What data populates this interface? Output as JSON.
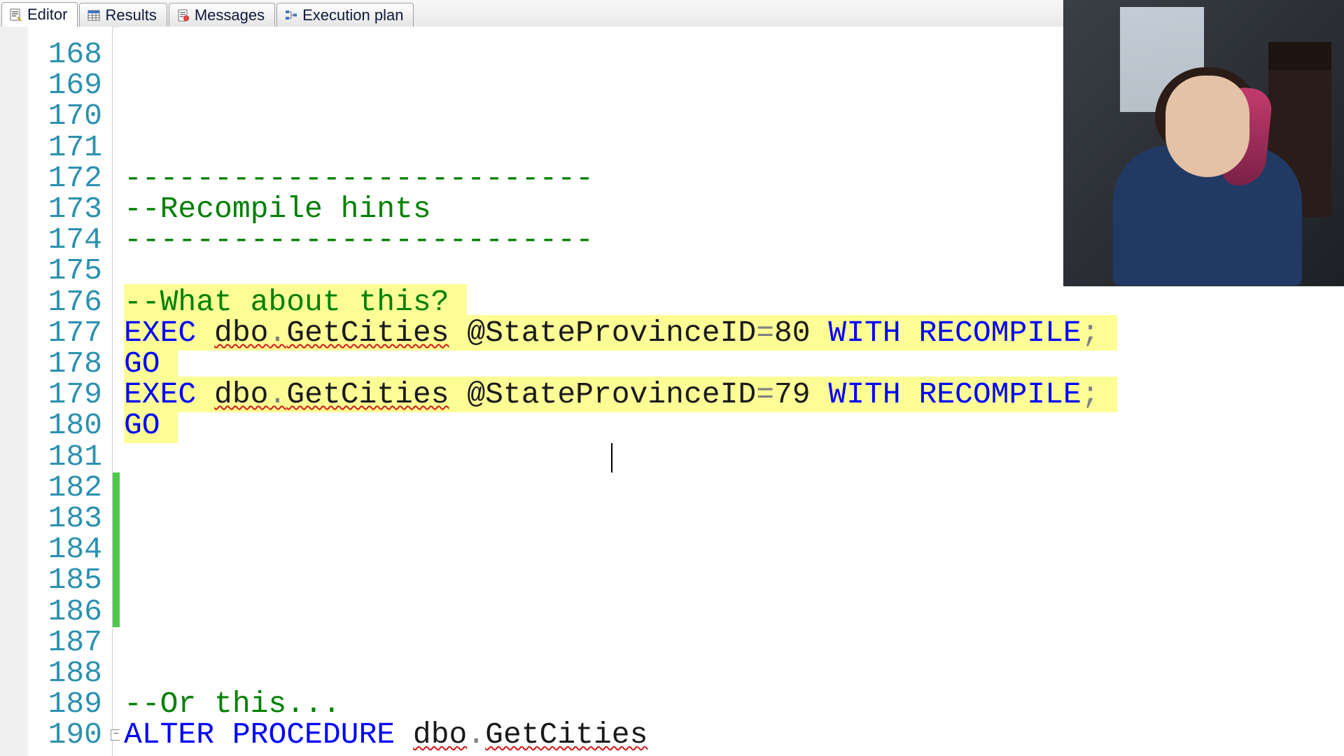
{
  "tabs": [
    {
      "label": "Editor",
      "active": true
    },
    {
      "label": "Results",
      "active": false
    },
    {
      "label": "Messages",
      "active": false
    },
    {
      "label": "Execution plan",
      "active": false
    }
  ],
  "editor": {
    "first_line": 168,
    "last_line": 190,
    "changed_lines_start": 182,
    "changed_lines_end": 186,
    "caret_line": 181,
    "fold_line": 190,
    "lines": {
      "168": [],
      "169": [],
      "170": [],
      "171": [],
      "172": [
        {
          "cls": "tok-comment",
          "text": "--------------------------"
        }
      ],
      "173": [
        {
          "cls": "tok-comment",
          "text": "--Recompile hints"
        }
      ],
      "174": [
        {
          "cls": "tok-comment",
          "text": "--------------------------"
        }
      ],
      "175": [],
      "176": [
        {
          "cls": "tok-comment",
          "text": "--What about this?",
          "sel": true
        }
      ],
      "177": [
        {
          "cls": "tok-kw",
          "text": "EXEC",
          "sel": true
        },
        {
          "cls": "tok-text",
          "text": " ",
          "sel": true
        },
        {
          "cls": "tok-text squiggle",
          "text": "dbo",
          "sel": true
        },
        {
          "cls": "tok-punct squiggle",
          "text": ".",
          "sel": true
        },
        {
          "cls": "tok-text squiggle",
          "text": "GetCities",
          "sel": true
        },
        {
          "cls": "tok-text",
          "text": " @StateProvinceID",
          "sel": true
        },
        {
          "cls": "tok-punct",
          "text": "=",
          "sel": true
        },
        {
          "cls": "tok-text",
          "text": "80 ",
          "sel": true
        },
        {
          "cls": "tok-kw",
          "text": "WITH",
          "sel": true
        },
        {
          "cls": "tok-text",
          "text": " ",
          "sel": true
        },
        {
          "cls": "tok-kw",
          "text": "RECOMPILE",
          "sel": true
        },
        {
          "cls": "tok-punct",
          "text": ";",
          "sel": true
        }
      ],
      "178": [
        {
          "cls": "tok-kw",
          "text": "GO",
          "sel": true
        }
      ],
      "179": [
        {
          "cls": "tok-kw",
          "text": "EXEC",
          "sel": true
        },
        {
          "cls": "tok-text",
          "text": " ",
          "sel": true
        },
        {
          "cls": "tok-text squiggle",
          "text": "dbo",
          "sel": true
        },
        {
          "cls": "tok-punct squiggle",
          "text": ".",
          "sel": true
        },
        {
          "cls": "tok-text squiggle",
          "text": "GetCities",
          "sel": true
        },
        {
          "cls": "tok-text",
          "text": " @StateProvinceID",
          "sel": true
        },
        {
          "cls": "tok-punct",
          "text": "=",
          "sel": true
        },
        {
          "cls": "tok-text",
          "text": "79 ",
          "sel": true
        },
        {
          "cls": "tok-kw",
          "text": "WITH",
          "sel": true
        },
        {
          "cls": "tok-text",
          "text": " ",
          "sel": true
        },
        {
          "cls": "tok-kw",
          "text": "RECOMPILE",
          "sel": true
        },
        {
          "cls": "tok-punct",
          "text": ";",
          "sel": true
        }
      ],
      "180": [
        {
          "cls": "tok-kw",
          "text": "GO",
          "sel": true
        }
      ],
      "181": [],
      "182": [],
      "183": [],
      "184": [],
      "185": [],
      "186": [],
      "187": [],
      "188": [],
      "189": [
        {
          "cls": "tok-comment",
          "text": "--Or this..."
        }
      ],
      "190": [
        {
          "cls": "tok-kw",
          "text": "ALTER"
        },
        {
          "cls": "tok-text",
          "text": " "
        },
        {
          "cls": "tok-kw",
          "text": "PROCEDURE"
        },
        {
          "cls": "tok-text",
          "text": " "
        },
        {
          "cls": "tok-text squiggle",
          "text": "dbo"
        },
        {
          "cls": "tok-punct",
          "text": "."
        },
        {
          "cls": "tok-text squiggle",
          "text": "GetCities"
        }
      ]
    }
  },
  "icons": {
    "editor": "editor-icon",
    "results": "results-grid-icon",
    "messages": "messages-icon",
    "execution_plan": "execution-plan-icon"
  }
}
